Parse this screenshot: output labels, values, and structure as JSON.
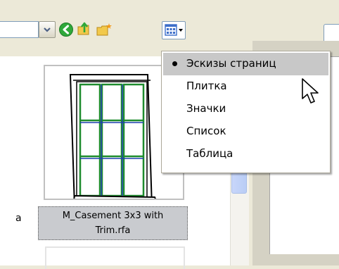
{
  "toolbar": {
    "combo_value": "",
    "icons": [
      "dropdown-arrow-icon",
      "back-arrow-icon",
      "up-folder-icon",
      "new-folder-icon",
      "view-menu-icon"
    ]
  },
  "file_list": {
    "partial_left_label": "a",
    "thumbnail_caption_line1": "M_Casement 3x3 with",
    "thumbnail_caption_line2": "Trim.rfa"
  },
  "view_menu": {
    "items": [
      {
        "label": "Эскизы страниц",
        "checked": true
      },
      {
        "label": "Плитка",
        "checked": false
      },
      {
        "label": "Значки",
        "checked": false
      },
      {
        "label": "Список",
        "checked": false
      },
      {
        "label": "Таблица",
        "checked": false
      }
    ]
  },
  "colors": {
    "window_bg": "#ECE9D8",
    "menu_highlight": "#C8C8C8",
    "selection_bg": "#C9CBCF",
    "accent_blue": "#7F9DB9"
  }
}
